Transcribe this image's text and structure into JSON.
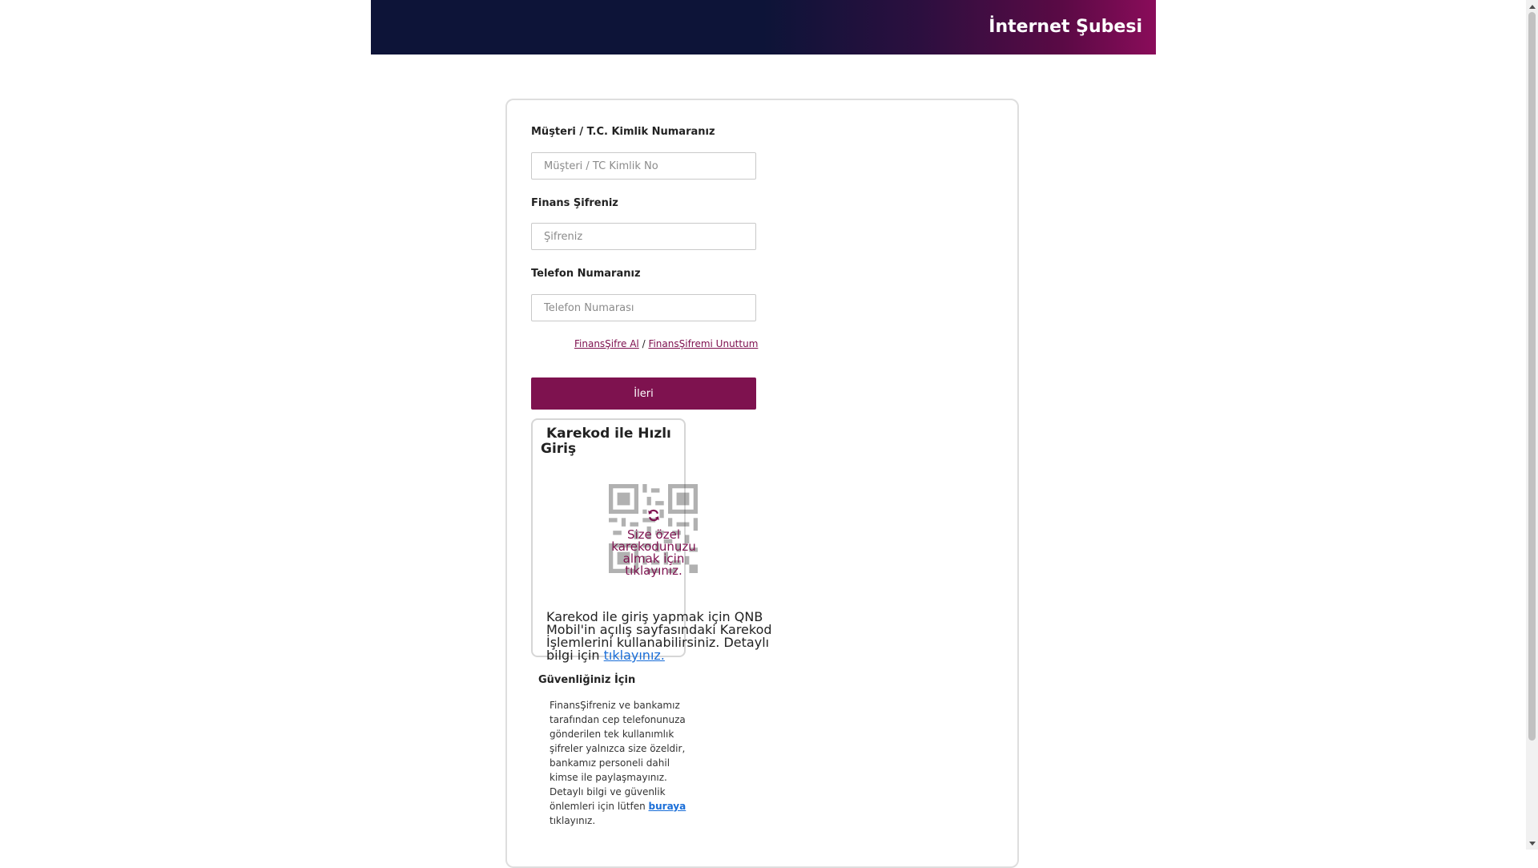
{
  "header": {
    "title": "İnternet Şubesi"
  },
  "form": {
    "customer_label": "Müşteri / T.C. Kimlik Numaranız",
    "customer_placeholder": "Müşteri / TC Kimlik No",
    "customer_value": "",
    "password_label": "Finans Şifreniz",
    "password_placeholder": "Şifreniz",
    "password_value": "",
    "phone_label": "Telefon Numaranız",
    "phone_placeholder": "Telefon Numarası",
    "phone_value": "",
    "link_get_password": "FinansŞifre Al",
    "link_separator": " / ",
    "link_forgot_password": "FinansŞifremi Unuttum",
    "next_button": "İleri"
  },
  "qr": {
    "title": "Karekod ile Hızlı Giriş",
    "overlay_text": "Size özel karekodunuzu almak için tıklayınız.",
    "info_text": "Karekod ile giriş yapmak için QNB Mobil'in açılış sayfasındaki Karekod İşlemlerini kullanabilirsiniz. Detaylı bilgi için",
    "info_link": "tıklayınız."
  },
  "security": {
    "title": "Güvenliğiniz İçin",
    "text_before": "FinansŞifreniz ve bankamız tarafından cep telefonunuza gönderilen tek kullanımlık şifreler yalnızca size özeldir, bankamız personeli dahil kimse ile paylaşmayınız. Detaylı bilgi ve güvenlik önlemleri için lütfen",
    "link": "buraya",
    "text_after": "tıklayınız."
  },
  "colors": {
    "brand_primary": "#7e124f",
    "header_dark": "#0d1438",
    "link_blue": "#1a6ed8"
  },
  "icons": {
    "qr": "qr-code-icon",
    "refresh": "refresh-icon"
  }
}
